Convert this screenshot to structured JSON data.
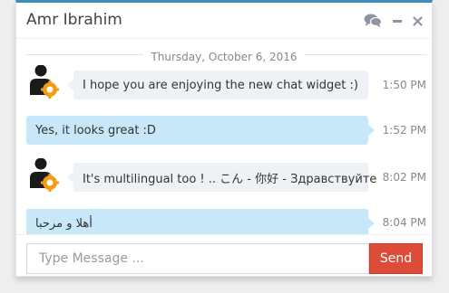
{
  "header": {
    "title": "Amr Ibrahim",
    "tools": [
      {
        "icon": "comments-icon"
      },
      {
        "icon": "minimize-icon"
      },
      {
        "icon": "close-icon"
      }
    ]
  },
  "date_divider": "Thursday, October 6, 2016",
  "messages": [
    {
      "direction": "incoming",
      "text": "I hope you are enjoying the new chat widget :)",
      "time": "1:50 PM"
    },
    {
      "direction": "outgoing",
      "text": "Yes, it looks great :D",
      "time": "1:52 PM"
    },
    {
      "direction": "incoming",
      "text": "It's multilingual too ! .. こん - 你好 - Здравствуйте",
      "time": "8:02 PM"
    },
    {
      "direction": "outgoing",
      "text": "أهلا و مرحبا",
      "time": "8:04 PM"
    }
  ],
  "composer": {
    "placeholder": "Type Message ...",
    "send_label": "Send"
  },
  "colors": {
    "accent": "#3c8dbc",
    "incoming_bubble": "#eef2f7",
    "outgoing_bubble": "#c8e8fa",
    "send_button": "#dd4b39",
    "avatar_badge": "#f39c12"
  }
}
